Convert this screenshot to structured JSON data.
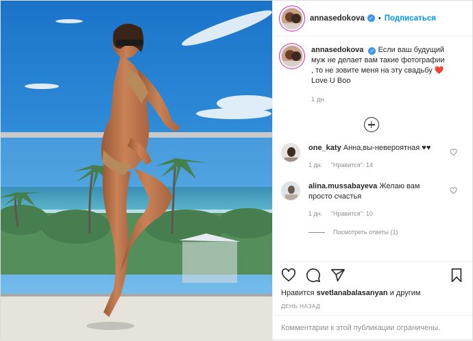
{
  "post": {
    "author": "annasedokova",
    "follow_label": "Подписаться",
    "separator": "•",
    "caption_text": "Если ваш будущий муж не делает вам такие фотографии , то не зовите меня на эту свадьбу ❤️ Love U Boo",
    "caption_time": "1 дн.",
    "comments": [
      {
        "user": "one_katy",
        "text": "Анна,вы-невероятная ♥♥",
        "time": "1 дн.",
        "likes": "\"Нравится\": 14"
      },
      {
        "user": "alina.mussabayeva",
        "text": "Желаю вам просто счастья",
        "time": "1 дн.",
        "likes": "\"Нравится\": 10",
        "replies": "Посмотреть ответы (1)"
      }
    ],
    "likes_prefix": "Нравится",
    "likes_user": "svetlanabalasanyan",
    "likes_suffix": "и другим",
    "date": "ДЕНЬ НАЗАД",
    "comments_limited": "Комментарии к этой публикации ограничены."
  },
  "icons": {
    "like": "heart-icon",
    "comment": "comment-icon",
    "share": "share-icon",
    "save": "bookmark-icon",
    "add": "plus-circle-icon",
    "verified": "verified-badge-icon"
  },
  "colors": {
    "link": "#0095f6",
    "verified": "#3897f0",
    "muted": "#8e8e8e",
    "text": "#262626"
  }
}
